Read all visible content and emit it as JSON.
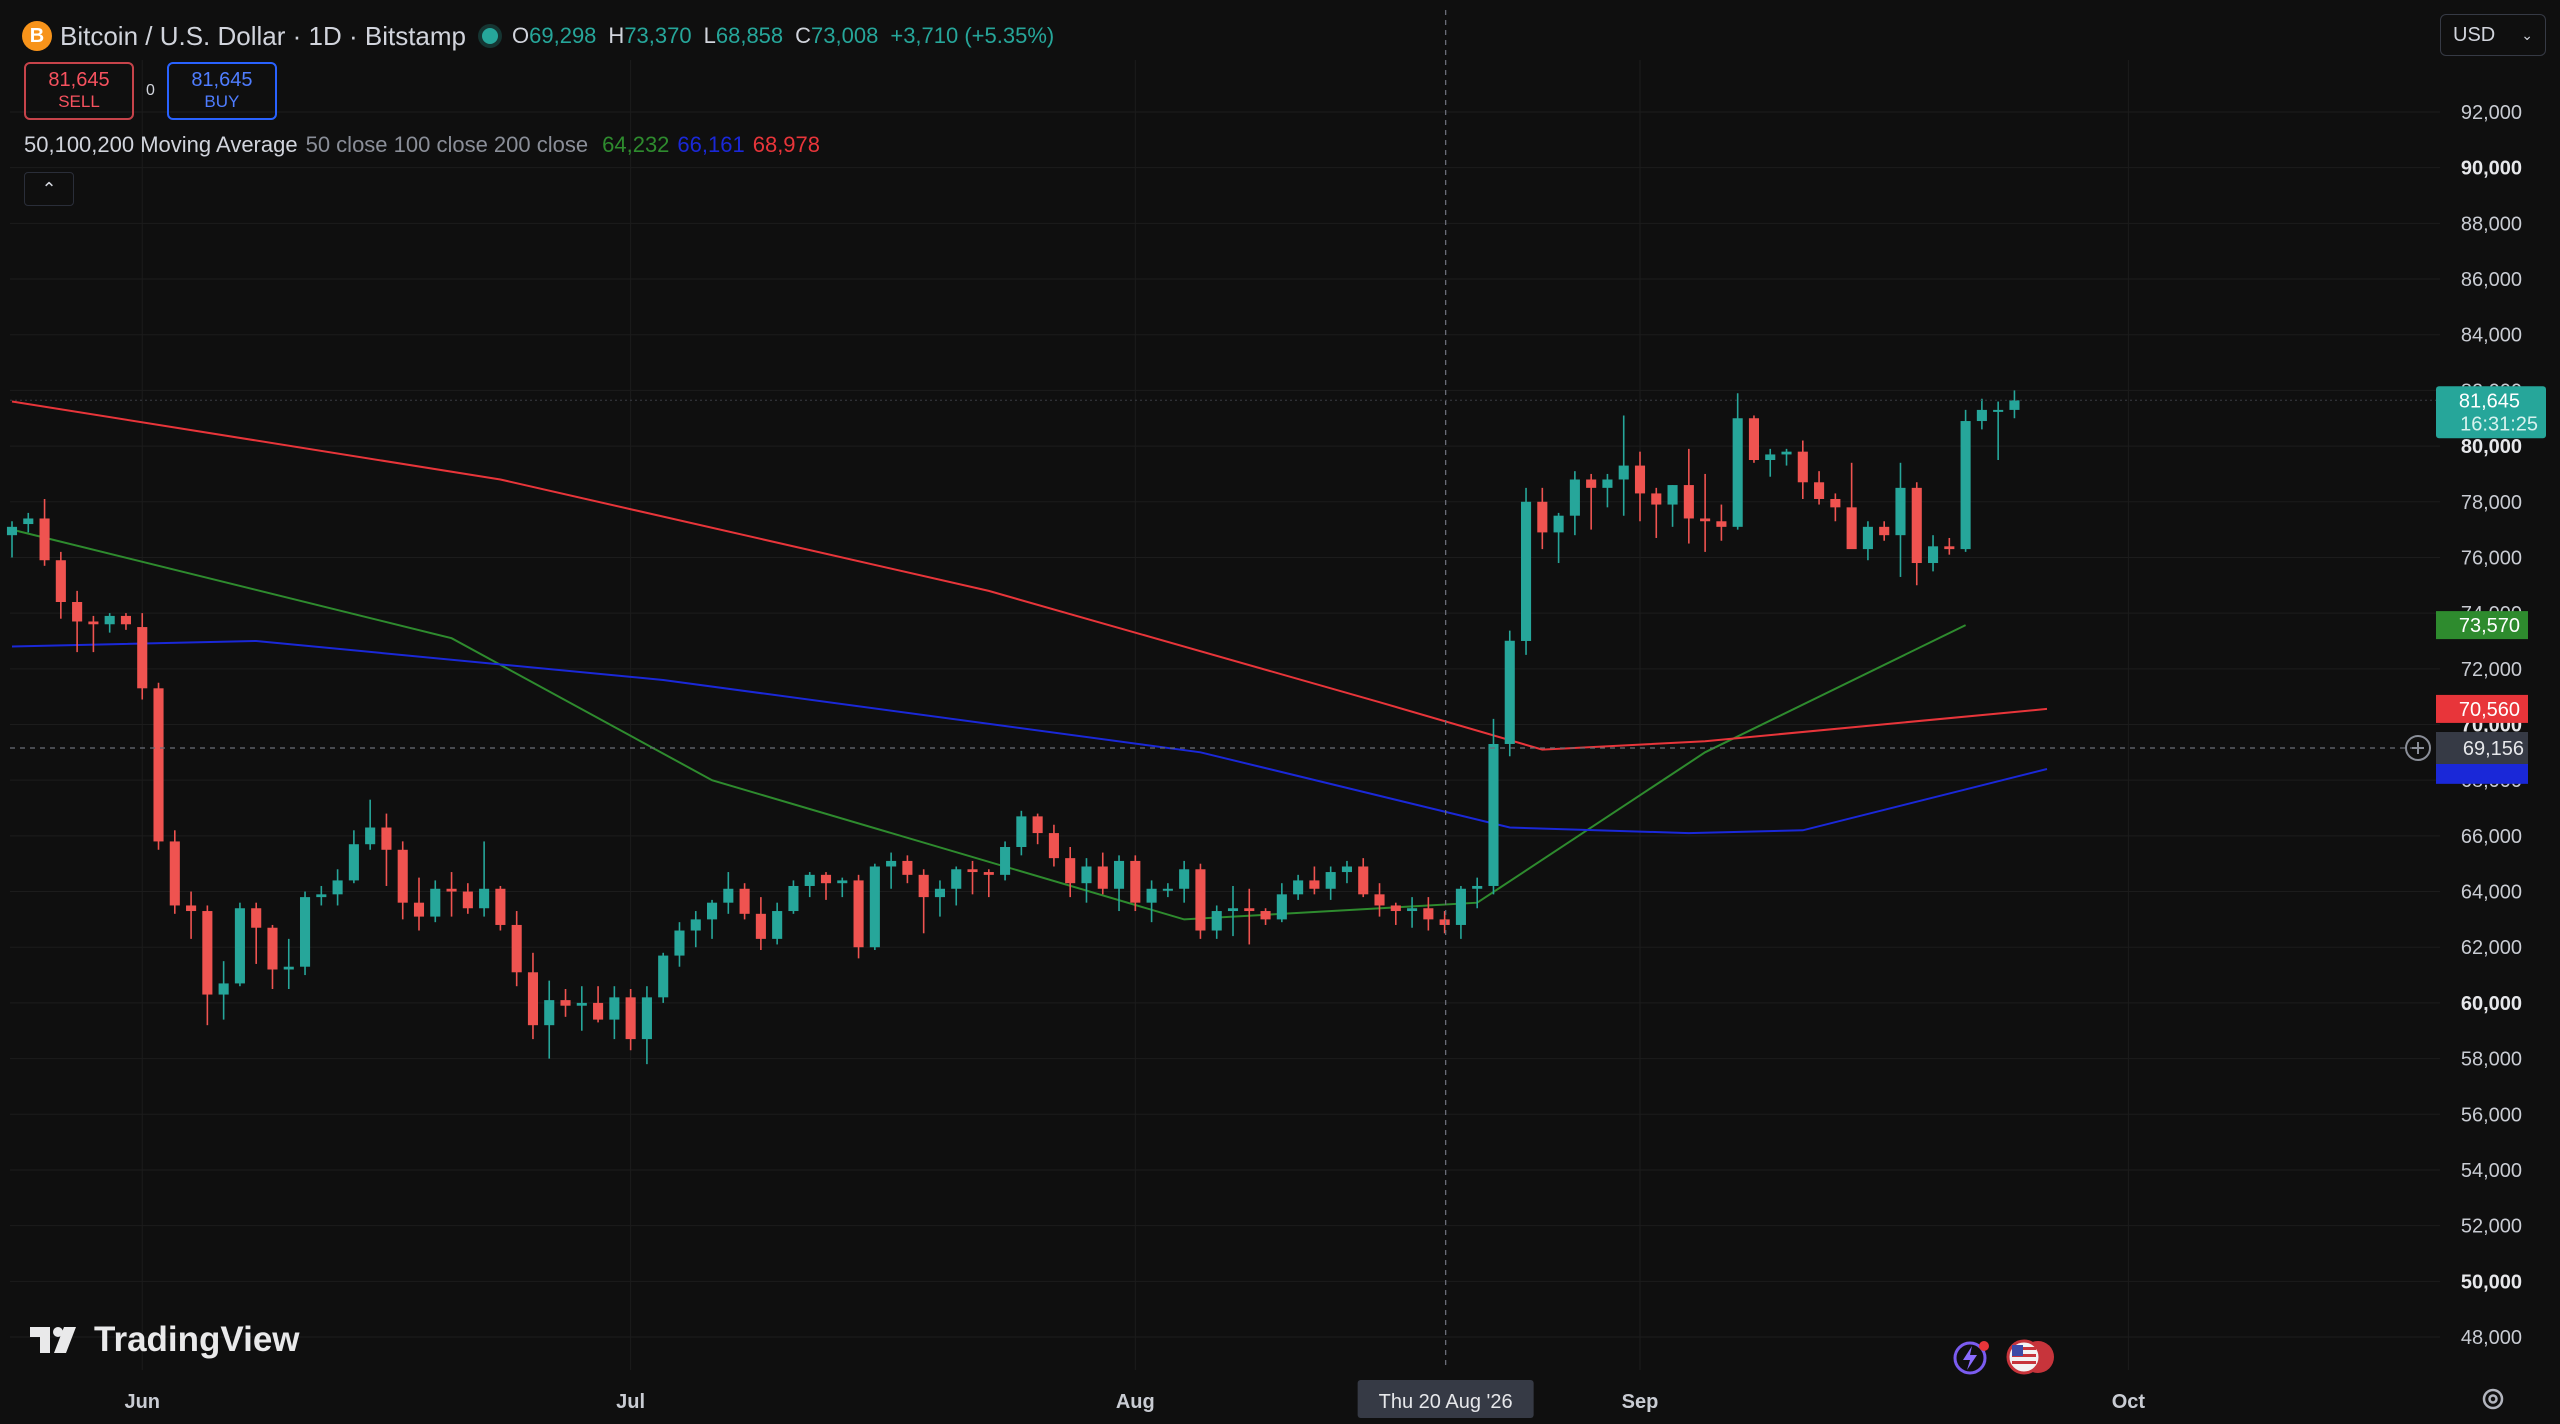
{
  "header": {
    "symbol_badge": "B",
    "symbol_title": "Bitcoin / U.S. Dollar · 1D · Bitstamp",
    "ohlc": [
      {
        "k": "O",
        "v": "69,298"
      },
      {
        "k": "H",
        "v": "73,370"
      },
      {
        "k": "L",
        "v": "68,858"
      },
      {
        "k": "C",
        "v": "73,008"
      }
    ],
    "change": "+3,710 (+5.35%)"
  },
  "trade": {
    "sell_price": "81,645",
    "sell_label": "SELL",
    "spread": "0",
    "buy_price": "81,645",
    "buy_label": "BUY"
  },
  "indicator": {
    "name": "50,100,200 Moving Average",
    "params": "50 close 100 close 200 close",
    "ma50": "64,232",
    "ma100": "66,161",
    "ma200": "68,978"
  },
  "currency": "USD",
  "brand": "TradingView",
  "colors": {
    "up": "#26a69a",
    "down": "#ef5350",
    "ma50": "#2e8b2e",
    "ma100": "#1a28d8",
    "ma200": "#e8353a",
    "background": "#0f0f0f"
  },
  "crosshair": {
    "date_label": "Thu 20 Aug '26",
    "price_label": "69,156"
  },
  "price_tags": {
    "last": "81,645",
    "countdown": "16:31:25",
    "ma50": "73,570",
    "ma200": "70,560"
  },
  "icons": [
    "bitcoin-icon",
    "chevron-up-icon",
    "chevron-down-icon",
    "plus-circle-icon",
    "lightning-icon",
    "us-flag-icon",
    "settings-icon"
  ],
  "chart_data": {
    "type": "candlestick",
    "y_range": [
      47000,
      93500
    ],
    "y_ticks": [
      48000,
      50000,
      52000,
      54000,
      56000,
      58000,
      60000,
      62000,
      64000,
      66000,
      68000,
      70000,
      72000,
      74000,
      76000,
      78000,
      80000,
      82000,
      84000,
      86000,
      88000,
      90000,
      92000
    ],
    "y_tick_labels": [
      "48,000",
      "50,000",
      "52,000",
      "54,000",
      "56,000",
      "58,000",
      "60,000",
      "62,000",
      "64,000",
      "66,000",
      "68,000",
      "70,000",
      "72,000",
      "74,000",
      "76,000",
      "78,000",
      "80,000",
      "82,000",
      "84,000",
      "86,000",
      "88,000",
      "90,000",
      "92,000"
    ],
    "x_labels": [
      "Jun",
      "Jul",
      "Aug",
      "Sep",
      "Oct"
    ],
    "x_label_dates": [
      "Jun 1",
      "Jul 1",
      "Aug 1",
      "Sep 1",
      "Oct 1"
    ],
    "dates": [
      "May 24",
      "May 25",
      "May 26",
      "May 27",
      "May 28",
      "May 29",
      "May 30",
      "May 31",
      "Jun 1",
      "Jun 2",
      "Jun 3",
      "Jun 4",
      "Jun 5",
      "Jun 6",
      "Jun 7",
      "Jun 8",
      "Jun 9",
      "Jun 10",
      "Jun 11",
      "Jun 12",
      "Jun 13",
      "Jun 14",
      "Jun 15",
      "Jun 16",
      "Jun 17",
      "Jun 18",
      "Jun 19",
      "Jun 20",
      "Jun 21",
      "Jun 22",
      "Jun 23",
      "Jun 24",
      "Jun 25",
      "Jun 26",
      "Jun 27",
      "Jun 28",
      "Jun 29",
      "Jun 30",
      "Jul 1",
      "Jul 2",
      "Jul 3",
      "Jul 4",
      "Jul 5",
      "Jul 6",
      "Jul 7",
      "Jul 8",
      "Jul 9",
      "Jul 10",
      "Jul 11",
      "Jul 12",
      "Jul 13",
      "Jul 14",
      "Jul 15",
      "Jul 16",
      "Jul 17",
      "Jul 18",
      "Jul 19",
      "Jul 20",
      "Jul 21",
      "Jul 22",
      "Jul 23",
      "Jul 24",
      "Jul 25",
      "Jul 26",
      "Jul 27",
      "Jul 28",
      "Jul 29",
      "Jul 30",
      "Jul 31",
      "Aug 1",
      "Aug 2",
      "Aug 3",
      "Aug 4",
      "Aug 5",
      "Aug 6",
      "Aug 7",
      "Aug 8",
      "Aug 9",
      "Aug 10",
      "Aug 11",
      "Aug 12",
      "Aug 13",
      "Aug 14",
      "Aug 15",
      "Aug 16",
      "Aug 17",
      "Aug 18",
      "Aug 19",
      "Aug 20",
      "Aug 21",
      "Aug 22",
      "Aug 23",
      "Aug 24",
      "Aug 25",
      "Aug 26",
      "Aug 27",
      "Aug 28",
      "Aug 29",
      "Aug 30",
      "Aug 31",
      "Sep 1",
      "Sep 2",
      "Sep 3",
      "Sep 4",
      "Sep 5",
      "Sep 6",
      "Sep 7",
      "Sep 8",
      "Sep 9",
      "Sep 10",
      "Sep 11",
      "Sep 12",
      "Sep 13",
      "Sep 14",
      "Sep 15",
      "Sep 16",
      "Sep 17",
      "Sep 18",
      "Sep 19",
      "Sep 20",
      "Sep 21"
    ],
    "ohlc": [
      [
        76800,
        77300,
        76000,
        77100
      ],
      [
        77200,
        77600,
        76900,
        77400
      ],
      [
        77400,
        78100,
        75700,
        75900
      ],
      [
        75900,
        76200,
        73800,
        74400
      ],
      [
        74400,
        74800,
        72600,
        73700
      ],
      [
        73700,
        73900,
        72600,
        73600
      ],
      [
        73600,
        74000,
        73300,
        73900
      ],
      [
        73900,
        74000,
        73400,
        73600
      ],
      [
        73500,
        74000,
        70900,
        71300
      ],
      [
        71300,
        71500,
        65500,
        65800
      ],
      [
        65800,
        66200,
        63200,
        63500
      ],
      [
        63500,
        64000,
        62300,
        63300
      ],
      [
        63300,
        63500,
        59200,
        60300
      ],
      [
        60300,
        61500,
        59400,
        60700
      ],
      [
        60700,
        63600,
        60600,
        63400
      ],
      [
        63400,
        63600,
        61400,
        62700
      ],
      [
        62700,
        62800,
        60500,
        61200
      ],
      [
        61200,
        62300,
        60500,
        61300
      ],
      [
        61300,
        64000,
        61000,
        63800
      ],
      [
        63800,
        64200,
        63500,
        63900
      ],
      [
        63900,
        64800,
        63500,
        64400
      ],
      [
        64400,
        66200,
        64300,
        65700
      ],
      [
        65700,
        67300,
        65500,
        66300
      ],
      [
        66300,
        66800,
        64200,
        65500
      ],
      [
        65500,
        65800,
        63000,
        63600
      ],
      [
        63600,
        64500,
        62600,
        63100
      ],
      [
        63100,
        64400,
        62900,
        64100
      ],
      [
        64100,
        64700,
        63100,
        64000
      ],
      [
        64000,
        64300,
        63200,
        63400
      ],
      [
        63400,
        65800,
        63100,
        64100
      ],
      [
        64100,
        64200,
        62600,
        62800
      ],
      [
        62800,
        63300,
        60600,
        61100
      ],
      [
        61100,
        61800,
        58700,
        59200
      ],
      [
        59200,
        60800,
        58000,
        60100
      ],
      [
        60100,
        60500,
        59500,
        59900
      ],
      [
        59900,
        60600,
        59000,
        60000
      ],
      [
        60000,
        60600,
        59300,
        59400
      ],
      [
        59400,
        60600,
        58700,
        60200
      ],
      [
        60200,
        60500,
        58300,
        58700
      ],
      [
        58700,
        60600,
        57800,
        60200
      ],
      [
        60200,
        61800,
        60000,
        61700
      ],
      [
        61700,
        62900,
        61300,
        62600
      ],
      [
        62600,
        63300,
        62000,
        63000
      ],
      [
        63000,
        63700,
        62300,
        63600
      ],
      [
        63600,
        64700,
        63200,
        64100
      ],
      [
        64100,
        64300,
        63000,
        63200
      ],
      [
        63200,
        63800,
        61900,
        62300
      ],
      [
        62300,
        63600,
        62100,
        63300
      ],
      [
        63300,
        64400,
        63200,
        64200
      ],
      [
        64200,
        64700,
        63800,
        64600
      ],
      [
        64600,
        64700,
        63700,
        64300
      ],
      [
        64300,
        64500,
        63800,
        64400
      ],
      [
        64400,
        64600,
        61600,
        62000
      ],
      [
        62000,
        65000,
        61900,
        64900
      ],
      [
        64900,
        65400,
        64100,
        65100
      ],
      [
        65100,
        65300,
        64300,
        64600
      ],
      [
        64600,
        64800,
        62500,
        63800
      ],
      [
        63800,
        64400,
        63100,
        64100
      ],
      [
        64100,
        64900,
        63500,
        64800
      ],
      [
        64800,
        65100,
        63900,
        64700
      ],
      [
        64700,
        64800,
        63800,
        64600
      ],
      [
        64600,
        65800,
        64400,
        65600
      ],
      [
        65600,
        66900,
        65300,
        66700
      ],
      [
        66700,
        66800,
        65700,
        66100
      ],
      [
        66100,
        66400,
        64900,
        65200
      ],
      [
        65200,
        65600,
        63800,
        64300
      ],
      [
        64300,
        65200,
        63600,
        64900
      ],
      [
        64900,
        65400,
        63900,
        64100
      ],
      [
        64100,
        65300,
        63300,
        65100
      ],
      [
        65100,
        65300,
        63300,
        63600
      ],
      [
        63600,
        64400,
        62900,
        64100
      ],
      [
        64100,
        64300,
        63800,
        64100
      ],
      [
        64100,
        65100,
        63600,
        64800
      ],
      [
        64800,
        65000,
        62300,
        62600
      ],
      [
        62600,
        63500,
        62300,
        63300
      ],
      [
        63300,
        64200,
        62400,
        63400
      ],
      [
        63400,
        64100,
        62100,
        63300
      ],
      [
        63300,
        63400,
        62800,
        63000
      ],
      [
        63000,
        64300,
        62900,
        63900
      ],
      [
        63900,
        64600,
        63700,
        64400
      ],
      [
        64400,
        64900,
        63900,
        64100
      ],
      [
        64100,
        64900,
        63700,
        64700
      ],
      [
        64700,
        65100,
        64300,
        64900
      ],
      [
        64900,
        65200,
        63800,
        63900
      ],
      [
        63900,
        64300,
        63100,
        63500
      ],
      [
        63500,
        63600,
        62800,
        63300
      ],
      [
        63300,
        63800,
        62700,
        63400
      ],
      [
        63400,
        63800,
        62600,
        63000
      ],
      [
        63000,
        63300,
        62500,
        62800
      ],
      [
        62800,
        64200,
        62300,
        64100
      ],
      [
        64100,
        64500,
        63400,
        64200
      ],
      [
        64200,
        70200,
        63900,
        69300
      ],
      [
        69300,
        73370,
        68858,
        73008
      ],
      [
        73000,
        78500,
        72500,
        78000
      ],
      [
        78000,
        78500,
        76300,
        76900
      ],
      [
        76900,
        77600,
        75800,
        77500
      ],
      [
        77500,
        79100,
        76800,
        78800
      ],
      [
        78800,
        79000,
        77000,
        78500
      ],
      [
        78500,
        79000,
        77800,
        78800
      ],
      [
        78800,
        81100,
        77500,
        79300
      ],
      [
        79300,
        79800,
        77300,
        78300
      ],
      [
        78300,
        78500,
        76700,
        77900
      ],
      [
        77900,
        78600,
        77100,
        78600
      ],
      [
        78600,
        79900,
        76500,
        77400
      ],
      [
        77400,
        79000,
        76200,
        77300
      ],
      [
        77300,
        77900,
        76600,
        77100
      ],
      [
        77100,
        81900,
        77000,
        81000
      ],
      [
        81000,
        81100,
        79400,
        79500
      ],
      [
        79500,
        79900,
        78900,
        79700
      ],
      [
        79700,
        79900,
        79300,
        79800
      ],
      [
        79800,
        80200,
        78100,
        78700
      ],
      [
        78700,
        79100,
        77900,
        78100
      ],
      [
        78100,
        78300,
        77300,
        77800
      ],
      [
        77800,
        79400,
        77100,
        76300
      ],
      [
        76300,
        77300,
        75900,
        77100
      ],
      [
        77100,
        77300,
        76600,
        76800
      ],
      [
        76800,
        79400,
        75300,
        78500
      ],
      [
        78500,
        78700,
        75000,
        75800
      ],
      [
        75800,
        76800,
        75500,
        76400
      ],
      [
        76400,
        76700,
        76100,
        76300
      ],
      [
        76300,
        81300,
        76200,
        80900
      ],
      [
        80900,
        81700,
        80600,
        81300
      ],
      [
        81300,
        81600,
        79500,
        81300
      ],
      [
        81300,
        82000,
        81000,
        81645
      ]
    ],
    "series": [
      {
        "name": "50",
        "points": [
          [
            0,
            77000
          ],
          [
            27,
            73100
          ],
          [
            43,
            68000
          ],
          [
            72,
            63000
          ],
          [
            90,
            63600
          ],
          [
            104,
            69000
          ],
          [
            120,
            73570
          ]
        ]
      },
      {
        "name": "100",
        "points": [
          [
            0,
            72800
          ],
          [
            15,
            73000
          ],
          [
            40,
            71600
          ],
          [
            73,
            69000
          ],
          [
            92,
            66300
          ],
          [
            103,
            66100
          ],
          [
            110,
            66200
          ],
          [
            125,
            68400
          ]
        ]
      },
      {
        "name": "200",
        "points": [
          [
            0,
            81600
          ],
          [
            30,
            78800
          ],
          [
            60,
            74800
          ],
          [
            84,
            70800
          ],
          [
            94,
            69100
          ],
          [
            104,
            69400
          ],
          [
            125,
            70560
          ]
        ]
      }
    ]
  }
}
